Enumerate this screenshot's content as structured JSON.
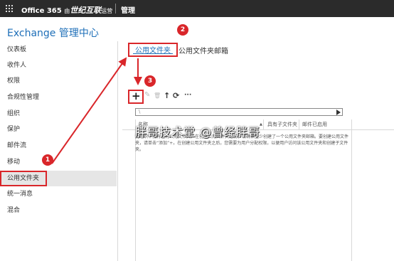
{
  "topbar": {
    "brand": "Office 365",
    "brand_cn_prefix": "由",
    "brand_cn": "世纪互联",
    "brand_cn_suffix": "运营",
    "admin_label": "管理"
  },
  "page_title": "Exchange 管理中心",
  "nav": {
    "items": [
      {
        "label": "仪表板"
      },
      {
        "label": "收件人"
      },
      {
        "label": "权限"
      },
      {
        "label": "合规性管理"
      },
      {
        "label": "组织"
      },
      {
        "label": "保护"
      },
      {
        "label": "邮件流"
      },
      {
        "label": "移动"
      },
      {
        "label": "公用文件夹"
      },
      {
        "label": "统一消息"
      },
      {
        "label": "混合"
      }
    ]
  },
  "tabs": [
    {
      "label": "公用文件夹"
    },
    {
      "label": "公用文件夹邮箱"
    }
  ],
  "toolbar": {
    "add": "+",
    "edit": "✎",
    "delete": "🗑",
    "up": "↑",
    "refresh": "⟳",
    "more": "···"
  },
  "pathbar": {
    "value": "\\"
  },
  "grid": {
    "columns": [
      "名称",
      "具有子文件夹",
      "邮件已启用"
    ],
    "sort_glyph": "▲",
    "empty_text": "此组织中没有任何公用文件夹。在创建公用文件夹之前，请确保至少创建了一个公用文件夹邮箱。要创建公用文件夹，请单击“添加”+。在创建公用文件夹之后，您需要为用户分配权限，以便用户访问该公用文件夹和创建子文件夹。"
  },
  "watermark": "胖哥技术堂 @曾经胖哥",
  "markers": [
    "1",
    "2",
    "3"
  ],
  "colors": {
    "topbar": "#2b2b2b",
    "accent": "#1e6fb8",
    "annotation": "#d9262a"
  }
}
